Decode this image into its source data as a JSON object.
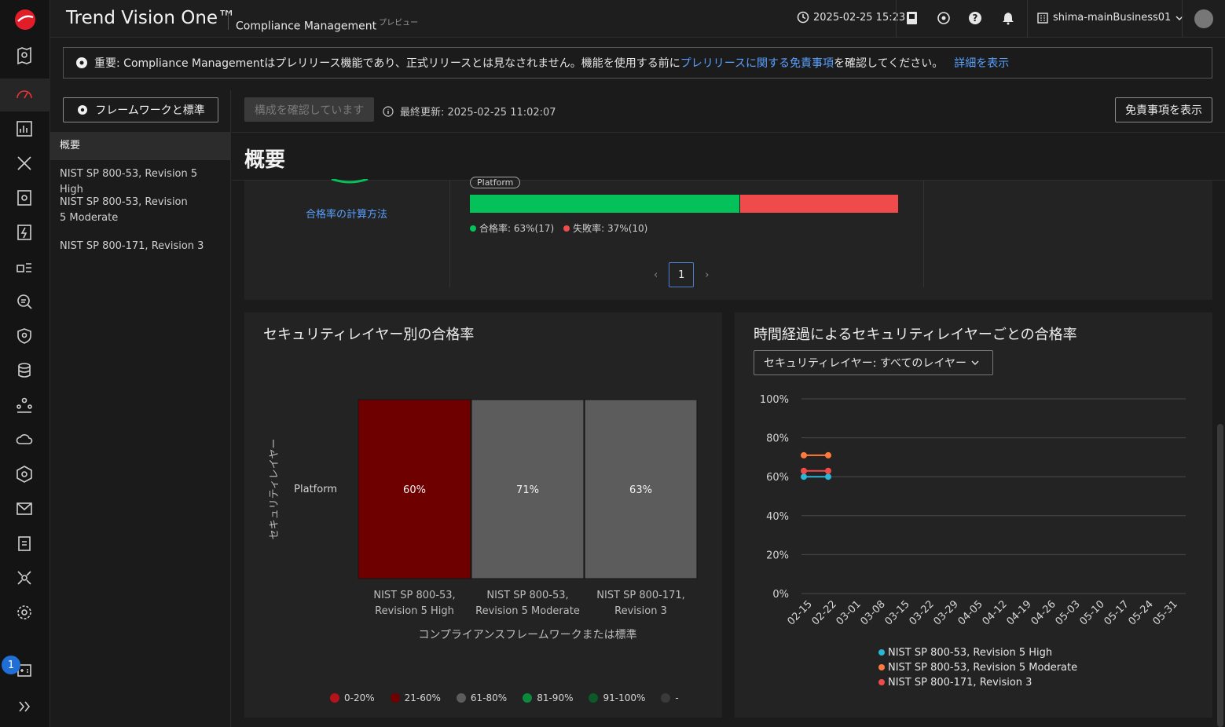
{
  "header": {
    "brand": "Trend Vision One™",
    "app": "Compliance Management",
    "app_tag": "プレビュー",
    "datetime": "2025-02-25 15:23",
    "tenant": "shima-mainBusiness01"
  },
  "notice": {
    "prefix": "重要: Compliance Managementはプレリリース機能であり、正式リリースとは見なされません。機能を使用する前に",
    "link": "プレリリースに関する免責事項",
    "suffix": "を確認してください。",
    "details": "詳細を表示"
  },
  "sidebar": {
    "framework_button": "フレームワークと標準",
    "items": [
      {
        "label": "概要"
      },
      {
        "label": "NIST SP 800-53, Revision 5 High"
      },
      {
        "label": "NIST SP 800-53, Revision 5 Moderate"
      },
      {
        "label": "NIST SP 800-171, Revision 3"
      }
    ],
    "badge_count": "1"
  },
  "toolbar": {
    "checking": "構成を確認しています",
    "last_updated": "最終更新: 2025-02-25 11:02:07",
    "disclaimer_button": "免責事項を表示"
  },
  "page_title": "概要",
  "summary_card": {
    "calc_link": "合格率の計算方法",
    "layer_label": "Platform",
    "pass_label": "合格率: 63%(17)",
    "fail_label": "失敗率: 37%(10)",
    "pass_fraction": 0.63,
    "page": "1"
  },
  "heatmap_card": {
    "title": "セキュリティレイヤー別の合格率",
    "legend": [
      {
        "label": "0-20%",
        "color": "#b5121b"
      },
      {
        "label": "21-60%",
        "color": "#6e0000"
      },
      {
        "label": "61-80%",
        "color": "#5c5c5c"
      },
      {
        "label": "81-90%",
        "color": "#0a8a3a"
      },
      {
        "label": "91-100%",
        "color": "#0b5a27"
      },
      {
        "label": "-",
        "color": "#3a3a3a"
      }
    ]
  },
  "line_card": {
    "title": "時間経過によるセキュリティレイヤーごとの合格率",
    "select_label": "セキュリティレイヤー: すべてのレイヤー",
    "legend": [
      {
        "label": "NIST SP 800-53, Revision 5 High",
        "color": "#2ab6d6"
      },
      {
        "label": "NIST SP 800-53, Revision 5 Moderate",
        "color": "#ff7a3d"
      },
      {
        "label": "NIST SP 800-171, Revision 3",
        "color": "#ef4b4b"
      }
    ]
  },
  "chart_data": [
    {
      "type": "heatmap",
      "title": "セキュリティレイヤー別の合格率",
      "xlabel": "コンプライアンスフレームワークまたは標準",
      "ylabel": "セキュリティレイヤー",
      "rows": [
        "Platform"
      ],
      "columns": [
        [
          "NIST SP 800-53,",
          "Revision 5 High"
        ],
        [
          "NIST SP 800-53,",
          "Revision 5 Moderate"
        ],
        [
          "NIST SP 800-171,",
          "Revision 3"
        ]
      ],
      "values": [
        [
          60,
          71,
          63
        ]
      ],
      "cell_labels": [
        [
          "60%",
          "71%",
          "63%"
        ]
      ],
      "cell_colors": [
        [
          "#6e0000",
          "#5c5c5c",
          "#5c5c5c"
        ]
      ]
    },
    {
      "type": "line",
      "title": "時間経過によるセキュリティレイヤーごとの合格率",
      "x": [
        "02-15",
        "02-22",
        "03-01",
        "03-08",
        "03-15",
        "03-22",
        "03-29",
        "04-05",
        "04-12",
        "04-19",
        "04-26",
        "05-03",
        "05-10",
        "05-17",
        "05-24",
        "05-31"
      ],
      "yticks": [
        "100%",
        "80%",
        "60%",
        "40%",
        "20%",
        "0%"
      ],
      "ylim": [
        0,
        100
      ],
      "series": [
        {
          "name": "NIST SP 800-53, Revision 5 High",
          "color": "#2ab6d6",
          "points": [
            [
              0,
              60
            ],
            [
              1,
              60
            ]
          ]
        },
        {
          "name": "NIST SP 800-53, Revision 5 Moderate",
          "color": "#ff7a3d",
          "points": [
            [
              0,
              71
            ],
            [
              1,
              71
            ]
          ]
        },
        {
          "name": "NIST SP 800-171, Revision 3",
          "color": "#ef4b4b",
          "points": [
            [
              0,
              63
            ],
            [
              1,
              63
            ]
          ]
        }
      ]
    }
  ]
}
